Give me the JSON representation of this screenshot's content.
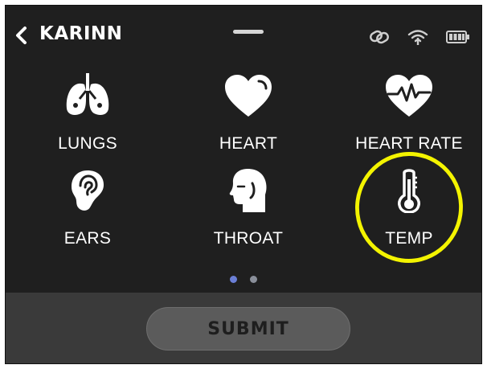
{
  "header": {
    "back_icon": "chevron-left-icon",
    "profile_name": "KARINN",
    "status_icons": [
      "link-icon",
      "wifi-icon",
      "battery-icon"
    ]
  },
  "exam_items": [
    {
      "label": "LUNGS",
      "icon": "lungs-icon"
    },
    {
      "label": "HEART",
      "icon": "heart-icon"
    },
    {
      "label": "HEART RATE",
      "icon": "heart-rate-icon"
    },
    {
      "label": "EARS",
      "icon": "ear-icon"
    },
    {
      "label": "THROAT",
      "icon": "throat-icon"
    },
    {
      "label": "TEMP",
      "icon": "thermometer-icon"
    }
  ],
  "highlighted_item": "TEMP",
  "pager": {
    "total": 2,
    "current": 1
  },
  "footer": {
    "submit_label": "SUBMIT"
  },
  "colors": {
    "background": "#1f1f1f",
    "footer_bg": "#3a3a3a",
    "submit_bg": "#5b5b5b",
    "highlight": "#f4f400",
    "dot_active": "#6b7fd6",
    "dot_inactive": "#8a8f9a"
  }
}
